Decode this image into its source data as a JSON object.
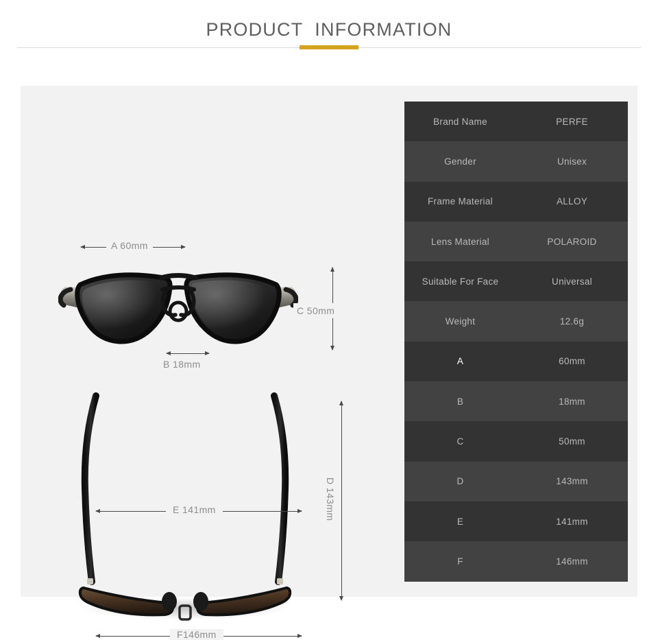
{
  "header": {
    "title": "PRODUCT  INFORMATION",
    "accent_color": "#d3a41b",
    "rule_color": "#d8d8d8",
    "title_color": "#5e5e5e"
  },
  "panel": {
    "background": "#f2f2f2"
  },
  "diagram": {
    "labels": {
      "a": "A 60mm",
      "b": "B 18mm",
      "c": "C 50mm",
      "d": "D 143mm",
      "e": "E 141mm",
      "f": "F146mm"
    },
    "views": {
      "front_view": "sunglasses-front-view",
      "top_view": "sunglasses-top-view"
    },
    "label_color": "#8d8d8d",
    "arrow_color": "#4a4a4a"
  },
  "spec_table": {
    "row_color_odd": "#333333",
    "row_color_even": "#424242",
    "text_color": "#b9b9b9",
    "rows": [
      {
        "label": "Brand Name",
        "value": "PERFE"
      },
      {
        "label": "Gender",
        "value": "Unisex"
      },
      {
        "label": "Frame Material",
        "value": "ALLOY"
      },
      {
        "label": "Lens Material",
        "value": "POLAROID"
      },
      {
        "label": "Suitable For Face",
        "value": "Universal"
      },
      {
        "label": "Weight",
        "value": "12.6g"
      },
      {
        "label": "A",
        "value": "60mm"
      },
      {
        "label": "B",
        "value": "18mm"
      },
      {
        "label": "C",
        "value": "50mm"
      },
      {
        "label": "D",
        "value": "143mm"
      },
      {
        "label": "E",
        "value": "141mm"
      },
      {
        "label": "F",
        "value": "146mm"
      }
    ]
  }
}
